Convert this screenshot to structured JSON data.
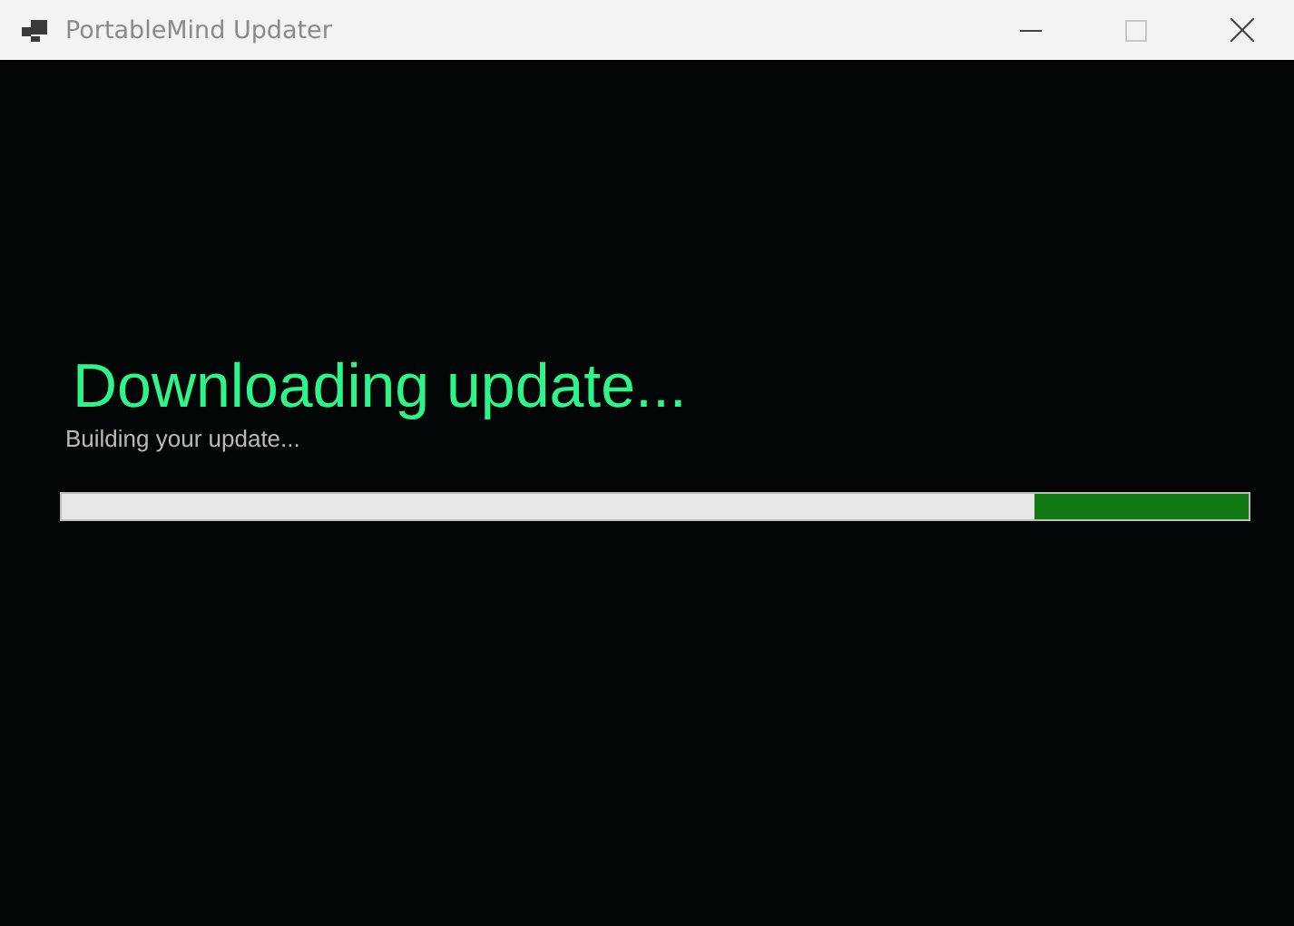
{
  "window": {
    "title": "PortableMind Updater"
  },
  "heading": "Downloading update...",
  "status": "Building your update...",
  "progress": {
    "level": 0.18
  }
}
